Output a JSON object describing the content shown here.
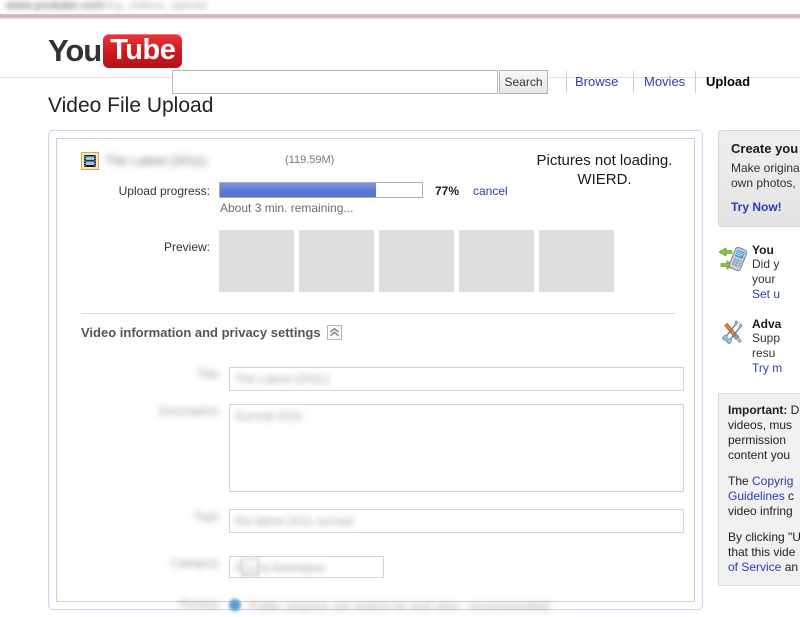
{
  "browser": {
    "url_primary": "www.youtube.com",
    "url_secondary": "/my_videos_upload"
  },
  "masthead": {
    "logo_you": "You",
    "logo_tube": "Tube",
    "search_value": "",
    "search_placeholder": "",
    "search_button": "Search",
    "nav": [
      {
        "label": "Browse",
        "active": false
      },
      {
        "label": "Movies",
        "active": false
      },
      {
        "label": "Upload",
        "active": true
      }
    ]
  },
  "page": {
    "title": "Video File Upload"
  },
  "upload": {
    "file_name": "The Latest (2011)",
    "file_size": "(119.59M)",
    "progress_label": "Upload progress:",
    "progress_percent": 77,
    "progress_percent_text": "77%",
    "cancel_label": "cancel",
    "time_remaining": "About 3 min. remaining...",
    "preview_label": "Preview:",
    "preview_thumbnails": [
      "",
      "",
      "",
      "",
      ""
    ]
  },
  "annotation": {
    "line1": "Pictures not loading.",
    "line2": "WIERD."
  },
  "section": {
    "header": "Video information and privacy settings",
    "collapse_icon": "double-chevron-up-icon"
  },
  "form": {
    "title": {
      "label": "Title",
      "value": "The Latest (2011)"
    },
    "description": {
      "label": "Description",
      "value": "Surreal 2011"
    },
    "tags": {
      "label": "Tags",
      "value": "the latest 2011 surreal"
    },
    "category": {
      "label": "Category",
      "value": "Film & Animation"
    },
    "privacy": {
      "label": "Privacy",
      "value": "Public (anyone can search for and view - recommended)"
    }
  },
  "sidebar": {
    "promo": {
      "title": "Create you",
      "body_line1": "Make origina",
      "body_line2": "own photos,",
      "link": "Try Now!"
    },
    "tips": [
      {
        "icon": "mobile-phone-sync-icon",
        "title": "You",
        "body_line1": "Did y",
        "body_line2": "your",
        "link": "Set u"
      },
      {
        "icon": "tools-wrench-screwdriver-icon",
        "title": "Adva",
        "body_line1": "Supp",
        "body_line2": "resu",
        "link": "Try m"
      }
    ],
    "legal": {
      "p1_bold": "Important:",
      "p1_rest": " D",
      "p1_line2": "videos, mus",
      "p1_line3": "permission ",
      "p1_line4": "content you ",
      "p2_pre": "The ",
      "p2_link1": "Copyrig",
      "p2_link2": "Guidelines",
      "p2_rest": " c",
      "p2_line3": "video infring",
      "p3_line1": "By clicking \"U",
      "p3_line2": "that this vide",
      "p3_link": "of Service",
      "p3_rest": " an"
    }
  },
  "colors": {
    "brand_red": "#cc181e",
    "link_blue": "#2b3eb0",
    "progress_blue": "#5b78d4",
    "panel_border_blue": "#c5d7ee",
    "thumb_gray": "#dedede"
  }
}
